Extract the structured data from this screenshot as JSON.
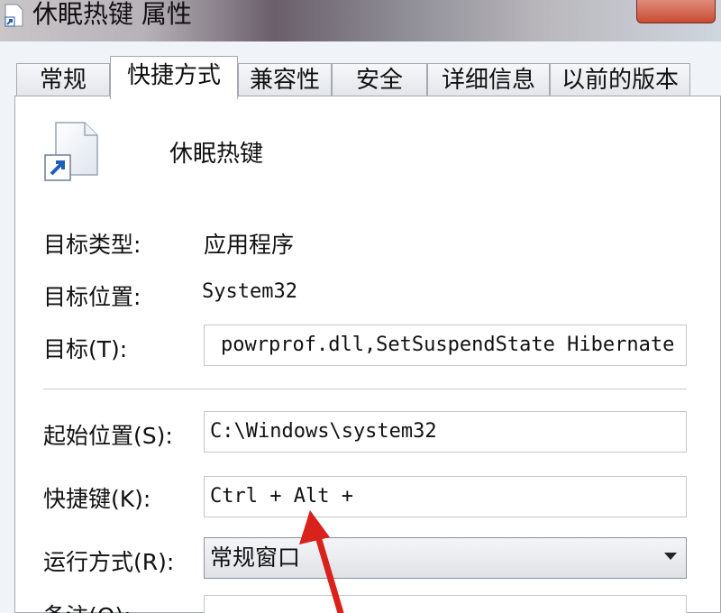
{
  "window": {
    "title": "休眠热键 属性"
  },
  "tabs": [
    {
      "label": "常规"
    },
    {
      "label": "快捷方式"
    },
    {
      "label": "兼容性"
    },
    {
      "label": "安全"
    },
    {
      "label": "详细信息"
    },
    {
      "label": "以前的版本"
    }
  ],
  "active_tab": "快捷方式",
  "shortcut": {
    "name": "休眠热键",
    "target_type_label": "目标类型:",
    "target_type_value": "应用程序",
    "target_location_label": "目标位置:",
    "target_location_value": "System32",
    "target_label": "目标(T):",
    "target_value": "powrprof.dll,SetSuspendState Hibernate",
    "start_in_label": "起始位置(S):",
    "start_in_value": "C:\\Windows\\system32",
    "hotkey_label": "快捷键(K):",
    "hotkey_value": "Ctrl + Alt +",
    "run_label": "运行方式(R):",
    "run_value": "常规窗口",
    "comment_label": "备注(O):"
  },
  "annotation": {
    "arrow_color": "#d9221c"
  },
  "colors": {
    "close_button": "#c94b34",
    "panel_bg": "#ffffff"
  }
}
